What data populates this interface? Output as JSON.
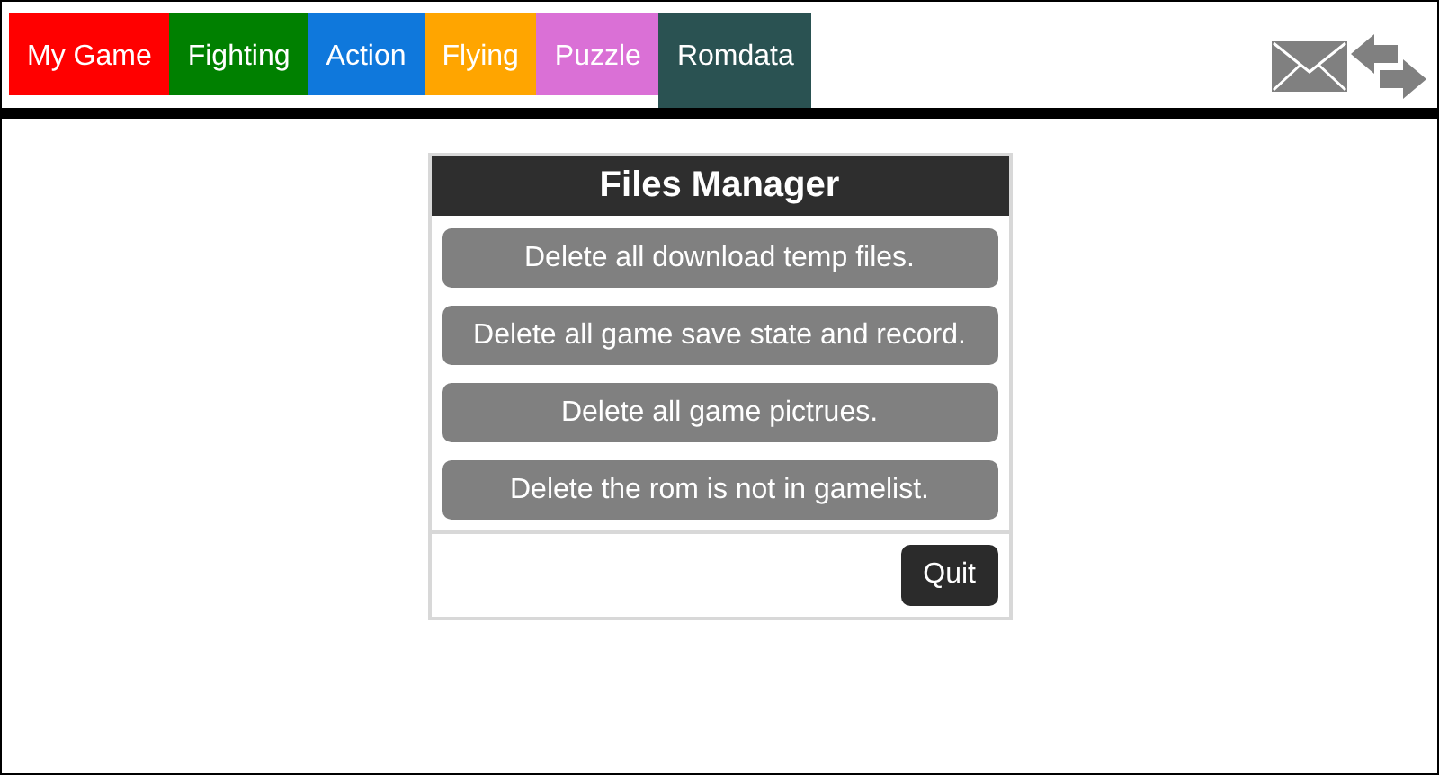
{
  "tabs": [
    {
      "label": "My Game",
      "color": "#ff0000",
      "selected": false
    },
    {
      "label": "Fighting",
      "color": "#008000",
      "selected": false
    },
    {
      "label": "Action",
      "color": "#0f78dc",
      "selected": false
    },
    {
      "label": "Flying",
      "color": "#ffa500",
      "selected": false
    },
    {
      "label": "Puzzle",
      "color": "#da70d6",
      "selected": false
    },
    {
      "label": "Romdata",
      "color": "#2a5252",
      "selected": true
    }
  ],
  "dialog": {
    "title": "Files Manager",
    "actions": [
      "Delete all download temp files.",
      "Delete all game save state and record.",
      "Delete all game pictrues.",
      "Delete the rom is not in gamelist."
    ],
    "quit": "Quit"
  }
}
